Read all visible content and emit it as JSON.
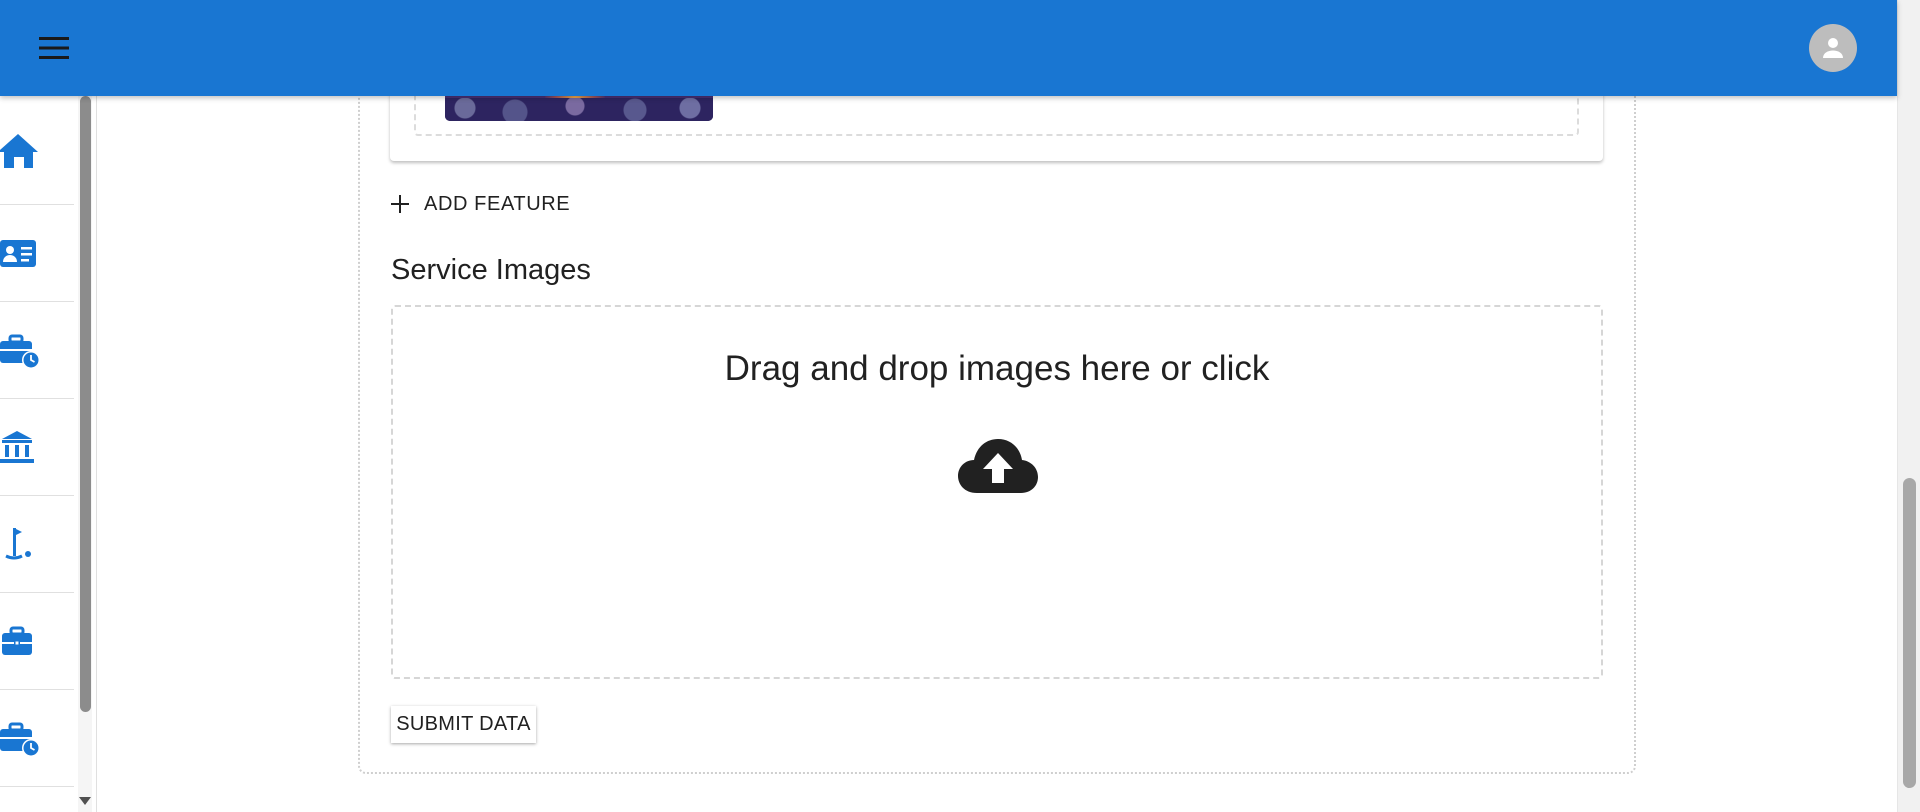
{
  "app_bar": {
    "menu_icon": "menu-icon",
    "avatar_icon": "person-icon",
    "color": "#1976d2"
  },
  "sidebar": {
    "items": [
      {
        "icon": "home-icon"
      },
      {
        "icon": "contact-card-icon"
      },
      {
        "icon": "work-history-icon"
      },
      {
        "icon": "bank-icon"
      },
      {
        "icon": "golf-icon"
      },
      {
        "icon": "briefcase-icon"
      },
      {
        "icon": "work-history-icon"
      }
    ]
  },
  "form": {
    "add_feature_label": "ADD FEATURE",
    "service_images_title": "Service Images",
    "dropzone_text": "Drag and drop images here or click",
    "dropzone_icon": "cloud-upload-icon",
    "submit_label": "SUBMIT DATA"
  }
}
